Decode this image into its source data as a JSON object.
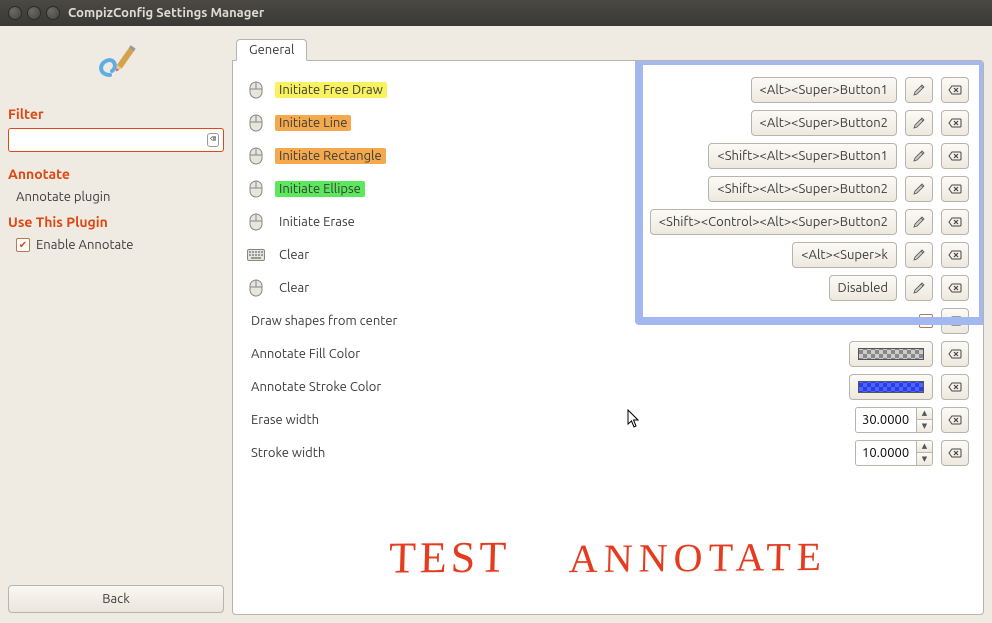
{
  "window": {
    "title": "CompizConfig Settings Manager"
  },
  "sidebar": {
    "filter": {
      "title": "Filter",
      "value": ""
    },
    "annotate": {
      "title": "Annotate",
      "link": "Annotate plugin"
    },
    "use": {
      "title": "Use This Plugin",
      "checkbox_label": "Enable Annotate",
      "checked": true
    },
    "back_label": "Back"
  },
  "tab": {
    "label": "General"
  },
  "rows": [
    {
      "icon": "mouse",
      "label": "Initiate Free Draw",
      "hl": "yellow",
      "shortcut": "<Alt><Super>Button1"
    },
    {
      "icon": "mouse",
      "label": "Initiate Line",
      "hl": "orange",
      "shortcut": "<Alt><Super>Button2"
    },
    {
      "icon": "mouse",
      "label": "Initiate Rectangle",
      "hl": "orange",
      "shortcut": "<Shift><Alt><Super>Button1"
    },
    {
      "icon": "mouse",
      "label": "Initiate Ellipse",
      "hl": "green",
      "shortcut": "<Shift><Alt><Super>Button2"
    },
    {
      "icon": "mouse",
      "label": "Initiate Erase",
      "hl": "",
      "shortcut": "<Shift><Control><Alt><Super>Button2"
    },
    {
      "icon": "keyboard",
      "label": "Clear",
      "hl": "",
      "shortcut": "<Alt><Super>k"
    },
    {
      "icon": "mouse",
      "label": "Clear",
      "hl": "",
      "shortcut": "Disabled"
    }
  ],
  "center": {
    "label": "Draw shapes from center",
    "checked": true
  },
  "fill": {
    "label": "Annotate Fill Color"
  },
  "stroke": {
    "label": "Annotate Stroke Color"
  },
  "erase_width": {
    "label": "Erase width",
    "value": "30.0000"
  },
  "stroke_width": {
    "label": "Stroke width",
    "value": "10.0000"
  },
  "handwriting": {
    "word1": "TEST",
    "word2": "ANNOTATE"
  },
  "colors": {
    "fill": "checker-gray",
    "stroke": "checker-blue"
  }
}
